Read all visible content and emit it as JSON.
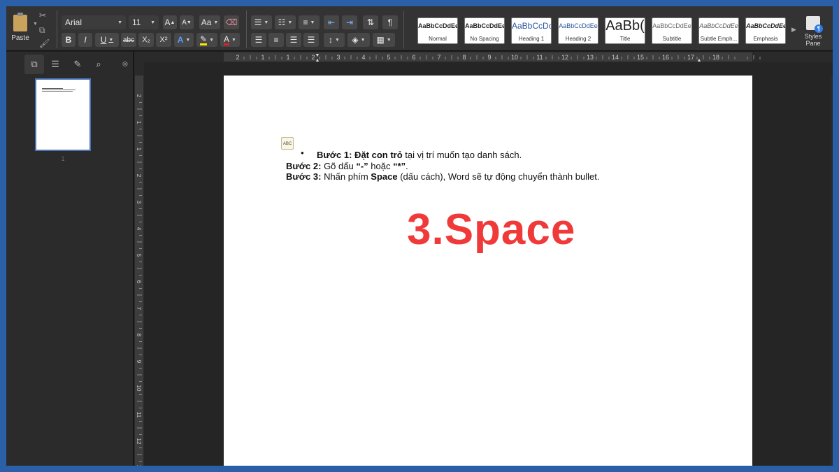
{
  "ribbon": {
    "paste_label": "Paste",
    "font_name": "Arial",
    "font_size": "11",
    "bold": "B",
    "italic": "I",
    "underline": "U",
    "strikethrough": "abc",
    "subscript": "X₂",
    "superscript": "X²",
    "text_effects": "A",
    "font_color": "A",
    "pilcrow": "¶",
    "grow_font": "A",
    "shrink_font": "A",
    "styles": [
      {
        "sample": "AaBbCcDdEe",
        "name": "Normal"
      },
      {
        "sample": "AaBbCcDdEe",
        "name": "No Spacing"
      },
      {
        "sample": "AaBbCcDc",
        "name": "Heading 1"
      },
      {
        "sample": "AaBbCcDdEe",
        "name": "Heading 2"
      },
      {
        "sample": "AaBb(",
        "name": "Title"
      },
      {
        "sample": "AaBbCcDdEe",
        "name": "Subtitle"
      },
      {
        "sample": "AaBbCcDdEe",
        "name": "Subtle Emph..."
      },
      {
        "sample": "AaBbCcDdEe",
        "name": "Emphasis"
      }
    ],
    "styles_pane_label_1": "Styles",
    "styles_pane_label_2": "Pane"
  },
  "sidebar": {
    "page_number": "1"
  },
  "ruler": {
    "h_labels": [
      "2",
      "1",
      "1",
      "2",
      "3",
      "4",
      "5",
      "6",
      "7",
      "8",
      "9",
      "10",
      "11",
      "12",
      "13",
      "14",
      "15",
      "16",
      "17",
      "18"
    ],
    "v_labels": [
      "2",
      "1",
      "1",
      "2",
      "3",
      "4",
      "5",
      "6",
      "7",
      "8",
      "9",
      "10",
      "11",
      "12",
      "13"
    ]
  },
  "document": {
    "autoformat_icon_text": "ABC",
    "bullet": "●",
    "line1_bold": "Bước 1: Đặt con trỏ",
    "line1_rest": " tại vị trí muốn tạo danh sách.",
    "line2_bold": "Bước 2:",
    "line2_a": " Gõ dấu ",
    "line2_dash": "“-”",
    "line2_b": " hoặc ",
    "line2_star": "“*”",
    "line2_c": ".",
    "line3_bold": "Bước 3:",
    "line3_a": " Nhấn phím ",
    "line3_space": "Space",
    "line3_b": " (dấu cách), Word sẽ tự động chuyển thành bullet.",
    "big_text": "3.Space"
  },
  "colors": {
    "big_text": "#f03a3a",
    "frame": "#2b5fa8"
  }
}
